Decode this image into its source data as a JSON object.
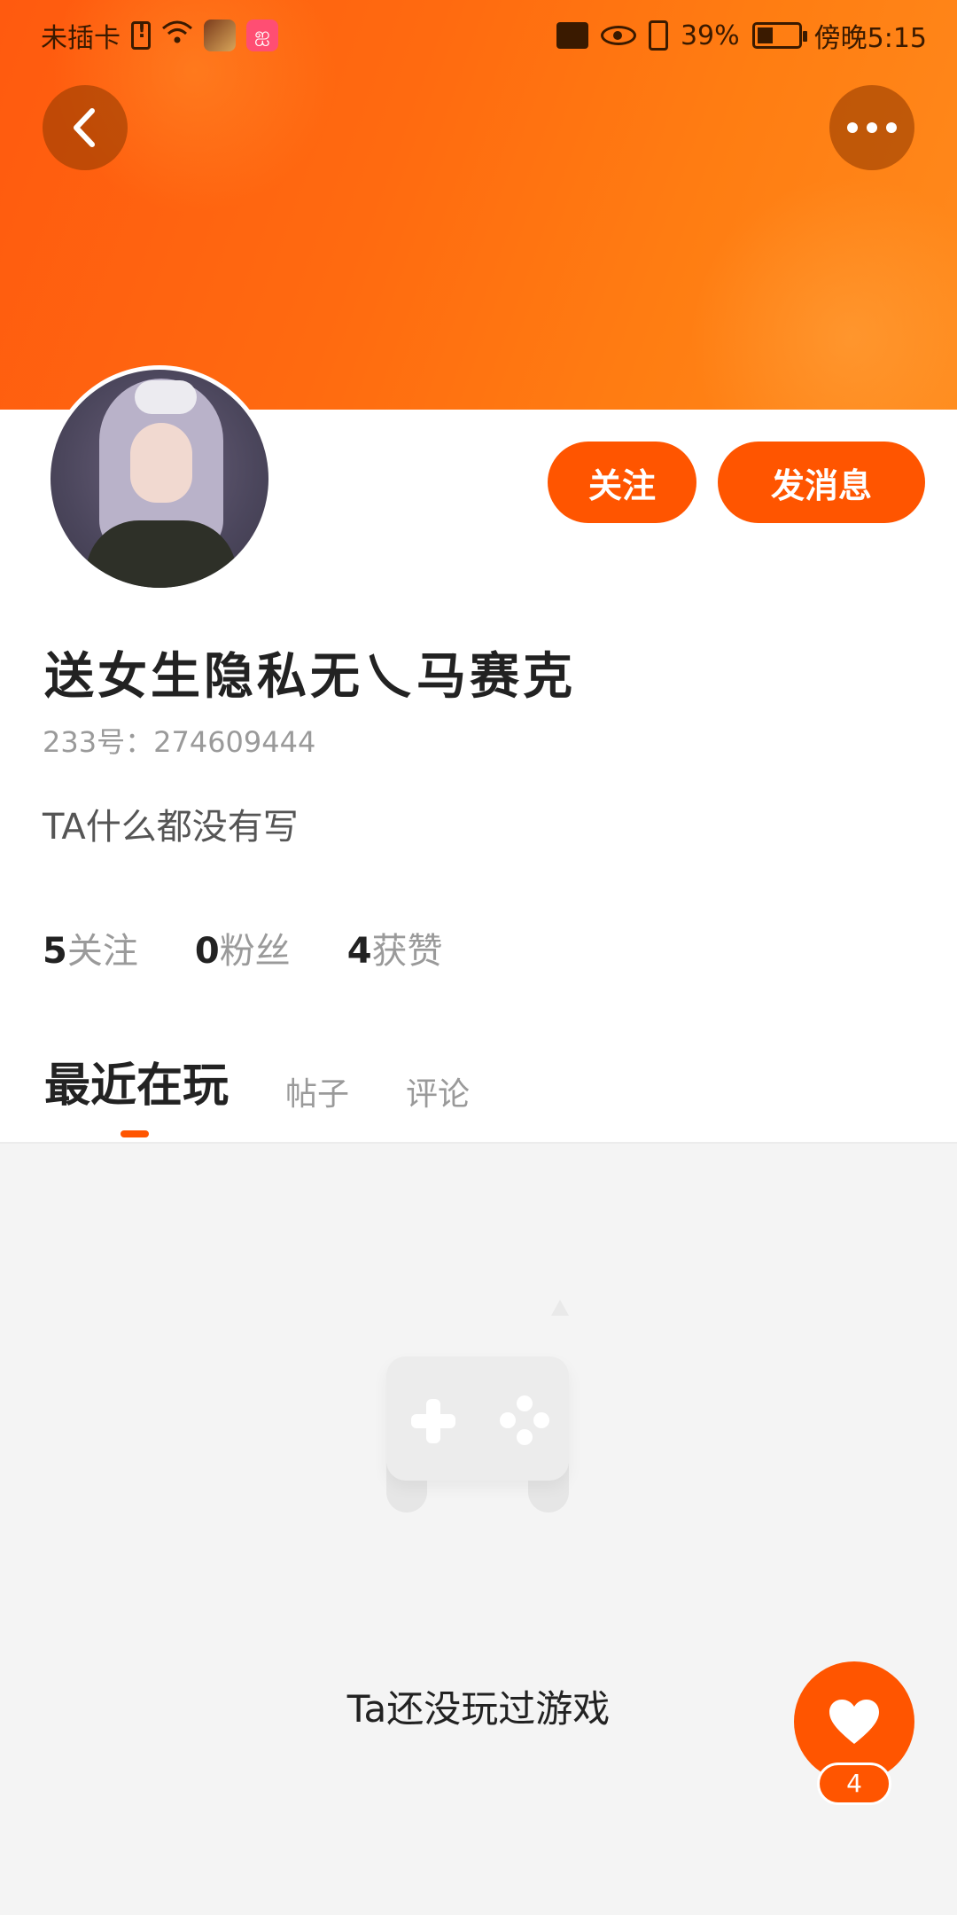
{
  "status_bar": {
    "carrier": "未插卡",
    "battery_percent": "39%",
    "time": "傍晚5:15",
    "battery_level": 0.39,
    "icons": [
      "sim-alert-icon",
      "wifi-icon",
      "game-app-icon",
      "video-app-icon",
      "work-bag-icon",
      "eye-icon",
      "vibrate-icon",
      "battery-charging-icon"
    ]
  },
  "header": {
    "back_icon": "chevron-left-icon",
    "more_icon": "more-dots-icon"
  },
  "profile": {
    "nickname": "送女生隐私无乀马赛克",
    "uid_label": "233号",
    "uid_separator": "：",
    "uid_value": "274609444",
    "bio": "TA什么都没有写",
    "follow_button": "关注",
    "message_button": "发消息"
  },
  "stats": [
    {
      "num": "5",
      "label": "关注"
    },
    {
      "num": "0",
      "label": "粉丝"
    },
    {
      "num": "4",
      "label": "获赞"
    }
  ],
  "tabs": [
    {
      "label": "最近在玩",
      "active": true
    },
    {
      "label": "帖子",
      "active": false
    },
    {
      "label": "评论",
      "active": false
    }
  ],
  "empty_state": {
    "icon": "gamepad-icon",
    "text": "Ta还没玩过游戏"
  },
  "like_fab": {
    "icon": "heart-icon",
    "count": "4"
  },
  "colors": {
    "accent": "#ff5500",
    "header_gradient_start": "#ff5a0f",
    "header_gradient_end": "#ff8a1c",
    "page_bg": "#f4f4f4"
  }
}
